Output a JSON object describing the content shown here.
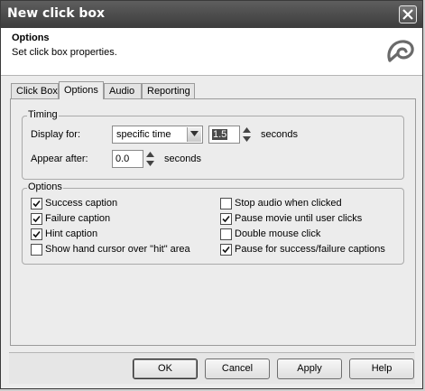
{
  "window": {
    "title": "New click box"
  },
  "header": {
    "title": "Options",
    "subtitle": "Set click box properties."
  },
  "tabs": [
    {
      "label": "Click Box",
      "active": false
    },
    {
      "label": "Options",
      "active": true
    },
    {
      "label": "Audio",
      "active": false
    },
    {
      "label": "Reporting",
      "active": false
    }
  ],
  "timing": {
    "group_label": "Timing",
    "display_for_label": "Display for:",
    "display_for_value": "specific time",
    "display_time_value": "1.5",
    "display_units": "seconds",
    "appear_after_label": "Appear after:",
    "appear_after_value": "0.0",
    "appear_units": "seconds"
  },
  "options": {
    "group_label": "Options",
    "items": [
      {
        "label": "Success caption",
        "checked": true
      },
      {
        "label": "Failure caption",
        "checked": true
      },
      {
        "label": "Hint caption",
        "checked": true
      },
      {
        "label": "Show hand cursor over \"hit\" area",
        "checked": false
      },
      {
        "label": "Stop audio when clicked",
        "checked": false
      },
      {
        "label": "Pause movie until user clicks",
        "checked": true
      },
      {
        "label": "Double mouse click",
        "checked": false
      },
      {
        "label": "Pause for success/failure captions",
        "checked": true
      }
    ]
  },
  "buttons": {
    "ok": "OK",
    "cancel": "Cancel",
    "apply": "Apply",
    "help": "Help"
  },
  "icons": {
    "close": "close-icon",
    "logo": "captivate-logo-icon",
    "dropdown": "chevron-down-icon",
    "check": "checkmark-icon"
  }
}
